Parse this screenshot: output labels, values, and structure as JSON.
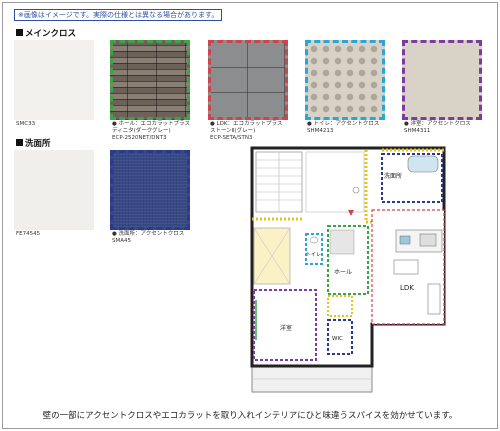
{
  "notice": "※画像はイメージです。実際の仕様とは異なる場合があります。",
  "sections": {
    "main_cloth": "メインクロス",
    "washroom": "洗面所"
  },
  "swatches": {
    "smc33": {
      "line1": "SMC33",
      "line2": ""
    },
    "hall": {
      "line1": "● ホール：エコカラットプラス",
      "line2": "ディニタ(ダークグレー)",
      "line3": "ECP-2520NET/DNT3"
    },
    "ldk": {
      "line1": "● LDK：エコカラットプラス",
      "line2": "ストーンⅡ(グレー)",
      "line3": "ECP-SETA/STN3"
    },
    "toilet": {
      "line1": "● トイレ：アクセントクロス",
      "line2": "SHM4213"
    },
    "western": {
      "line1": "● 洋室：アクセントクロス",
      "line2": "SHM4311"
    },
    "fe74545": {
      "line1": "FE74545"
    },
    "washroom_accent": {
      "line1": "● 洗面所：アクセントクロス",
      "line2": "SMA45"
    }
  },
  "plan": {
    "washroom": "洗面所",
    "toilet": "トイレ",
    "hall": "ホール",
    "ldk": "LDK",
    "western": "洋室",
    "wic": "WIC"
  },
  "colors": {
    "green": "#3aa545",
    "red": "#d0434b",
    "cyan": "#2aa6d6",
    "purple": "#7d3aa3",
    "navy": "#2a3a8c",
    "yellow": "#e8c21a"
  },
  "footer": "壁の一部にアクセントクロスやエコカラットを取り入れインテリアにひと味違うスパイスを効かせています。"
}
